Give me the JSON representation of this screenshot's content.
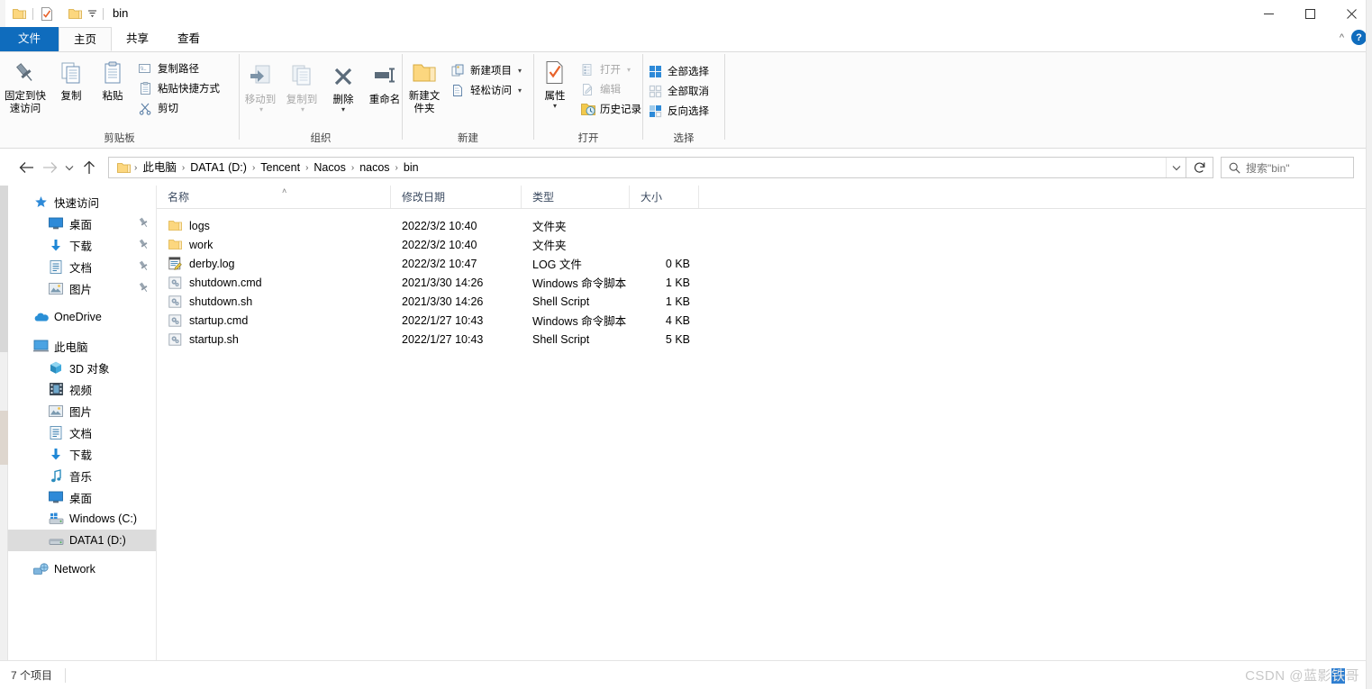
{
  "titlebar": {
    "title": "bin",
    "quick_access": [
      {
        "name": "folder-icon",
        "label": "bin"
      },
      {
        "name": "properties-icon",
        "label": "属性"
      },
      {
        "name": "new-folder-icon",
        "label": "新建文件夹"
      },
      {
        "name": "customize-dropdown-icon",
        "label": "自定义快速访问工具栏"
      }
    ],
    "window_controls": {
      "minimize": "—",
      "maximize": "☐",
      "close": "✕"
    }
  },
  "tabs": [
    {
      "id": "file",
      "label": "文件"
    },
    {
      "id": "home",
      "label": "主页"
    },
    {
      "id": "share",
      "label": "共享"
    },
    {
      "id": "view",
      "label": "查看"
    }
  ],
  "tabstrip_right": {
    "collapse_ribbon": "^",
    "help": "?"
  },
  "ribbon": {
    "groups": [
      {
        "id": "clipboard",
        "label": "剪贴板",
        "big_buttons": [
          {
            "name": "pin-to-quick-access-button",
            "label": "固定到快速访问",
            "icon": "pin-icon",
            "dim": false
          },
          {
            "name": "copy-button",
            "label": "复制",
            "icon": "copy-icon",
            "dim": false
          },
          {
            "name": "paste-button",
            "label": "粘贴",
            "icon": "paste-icon",
            "dim": false
          }
        ],
        "small_buttons": [
          {
            "name": "copy-path-button",
            "label": "复制路径",
            "icon": "copy-path-icon",
            "dim": false
          },
          {
            "name": "paste-shortcut-button",
            "label": "粘贴快捷方式",
            "icon": "paste-shortcut-icon",
            "dim": false
          },
          {
            "name": "cut-button",
            "label": "剪切",
            "icon": "scissors-icon",
            "dim": false
          }
        ]
      },
      {
        "id": "organize",
        "label": "组织",
        "big_buttons": [
          {
            "name": "move-to-button",
            "label": "移动到",
            "icon": "move-to-icon",
            "dim": true
          },
          {
            "name": "copy-to-button",
            "label": "复制到",
            "icon": "copy-to-icon",
            "dim": true
          },
          {
            "name": "delete-button",
            "label": "删除",
            "icon": "delete-x-icon",
            "dim": false
          },
          {
            "name": "rename-button",
            "label": "重命名",
            "icon": "rename-icon",
            "dim": false
          }
        ]
      },
      {
        "id": "new",
        "label": "新建",
        "big_buttons": [
          {
            "name": "new-folder-button",
            "label": "新建文件夹",
            "icon": "folder-icon",
            "dim": false
          }
        ],
        "small_buttons": [
          {
            "name": "new-item-button",
            "label": "新建项目",
            "icon": "new-item-icon",
            "dim": false
          },
          {
            "name": "easy-access-button",
            "label": "轻松访问",
            "icon": "easy-access-icon",
            "dim": false
          }
        ]
      },
      {
        "id": "open",
        "label": "打开",
        "big_buttons": [
          {
            "name": "properties-button",
            "label": "属性",
            "icon": "properties-icon",
            "dim": false
          }
        ],
        "small_buttons": [
          {
            "name": "open-button",
            "label": "打开",
            "icon": "open-icon",
            "dim": true
          },
          {
            "name": "edit-button",
            "label": "编辑",
            "icon": "edit-icon",
            "dim": true
          },
          {
            "name": "history-button",
            "label": "历史记录",
            "icon": "history-icon",
            "dim": false
          }
        ]
      },
      {
        "id": "select",
        "label": "选择",
        "small_buttons": [
          {
            "name": "select-all-button",
            "label": "全部选择",
            "icon": "select-all-icon",
            "dim": false
          },
          {
            "name": "select-none-button",
            "label": "全部取消",
            "icon": "select-none-icon",
            "dim": false
          },
          {
            "name": "invert-selection-button",
            "label": "反向选择",
            "icon": "invert-selection-icon",
            "dim": false
          }
        ]
      }
    ]
  },
  "addressbar": {
    "back": "←",
    "forward": "→",
    "recent": "˅",
    "up": "↑",
    "breadcrumbs": [
      "此电脑",
      "DATA1 (D:)",
      "Tencent",
      "Nacos",
      "nacos",
      "bin"
    ],
    "separator": "›",
    "dropdown": "˅",
    "refresh": "↻",
    "search_placeholder": "搜索\"bin\""
  },
  "navpane": {
    "items": [
      {
        "label": "快速访问",
        "icon": "star-pin-icon",
        "level": 0,
        "pinned": false,
        "selected": false
      },
      {
        "label": "桌面",
        "icon": "desktop-icon",
        "level": 1,
        "pinned": true,
        "selected": false
      },
      {
        "label": "下载",
        "icon": "downloads-icon",
        "level": 1,
        "pinned": true,
        "selected": false
      },
      {
        "label": "文档",
        "icon": "documents-icon",
        "level": 1,
        "pinned": true,
        "selected": false
      },
      {
        "label": "图片",
        "icon": "pictures-icon",
        "level": 1,
        "pinned": true,
        "selected": false
      },
      {
        "label": "OneDrive",
        "icon": "onedrive-cloud-icon",
        "level": 0,
        "pinned": false,
        "selected": false,
        "gap_before": true
      },
      {
        "label": "此电脑",
        "icon": "this-pc-icon",
        "level": 0,
        "pinned": false,
        "selected": false,
        "gap_before": true
      },
      {
        "label": "3D 对象",
        "icon": "3d-objects-icon",
        "level": 1,
        "pinned": false,
        "selected": false
      },
      {
        "label": "视频",
        "icon": "videos-icon",
        "level": 1,
        "pinned": false,
        "selected": false
      },
      {
        "label": "图片",
        "icon": "pictures-icon",
        "level": 1,
        "pinned": false,
        "selected": false
      },
      {
        "label": "文档",
        "icon": "documents-icon",
        "level": 1,
        "pinned": false,
        "selected": false
      },
      {
        "label": "下载",
        "icon": "downloads-icon",
        "level": 1,
        "pinned": false,
        "selected": false
      },
      {
        "label": "音乐",
        "icon": "music-icon",
        "level": 1,
        "pinned": false,
        "selected": false
      },
      {
        "label": "桌面",
        "icon": "desktop-icon",
        "level": 1,
        "pinned": false,
        "selected": false
      },
      {
        "label": "Windows (C:)",
        "icon": "windows-drive-icon",
        "level": 1,
        "pinned": false,
        "selected": false
      },
      {
        "label": "DATA1 (D:)",
        "icon": "hard-drive-icon",
        "level": 1,
        "pinned": false,
        "selected": true
      },
      {
        "label": "Network",
        "icon": "network-icon",
        "level": 0,
        "pinned": false,
        "selected": false,
        "gap_before": true
      }
    ]
  },
  "filelist": {
    "columns": [
      {
        "key": "name",
        "label": "名称",
        "sorted": true
      },
      {
        "key": "date",
        "label": "修改日期",
        "sorted": false
      },
      {
        "key": "type",
        "label": "类型",
        "sorted": false
      },
      {
        "key": "size",
        "label": "大小",
        "sorted": false
      }
    ],
    "sort_indicator": "˄",
    "rows": [
      {
        "name": "logs",
        "date": "2022/3/2 10:40",
        "type": "文件夹",
        "size": "",
        "icon": "folder-icon"
      },
      {
        "name": "work",
        "date": "2022/3/2 10:40",
        "type": "文件夹",
        "size": "",
        "icon": "folder-icon"
      },
      {
        "name": "derby.log",
        "date": "2022/3/2 10:47",
        "type": "LOG 文件",
        "size": "0 KB",
        "icon": "log-file-icon"
      },
      {
        "name": "shutdown.cmd",
        "date": "2021/3/30 14:26",
        "type": "Windows 命令脚本",
        "size": "1 KB",
        "icon": "script-file-icon"
      },
      {
        "name": "shutdown.sh",
        "date": "2021/3/30 14:26",
        "type": "Shell Script",
        "size": "1 KB",
        "icon": "script-file-icon"
      },
      {
        "name": "startup.cmd",
        "date": "2022/1/27 10:43",
        "type": "Windows 命令脚本",
        "size": "4 KB",
        "icon": "script-file-icon"
      },
      {
        "name": "startup.sh",
        "date": "2022/1/27 10:43",
        "type": "Shell Script",
        "size": "5 KB",
        "icon": "script-file-icon"
      }
    ]
  },
  "statusbar": {
    "item_count": "7 个项目"
  },
  "watermark": {
    "prefix": "CSDN @蓝影",
    "highlight": "铁",
    "suffix": "哥"
  },
  "colors": {
    "accent": "#0f6cbd",
    "file_tab": "#0f6cbd",
    "selection": "#dcdcdc",
    "folder_yellow": "#ffd277",
    "header_text": "#3b4a60"
  }
}
